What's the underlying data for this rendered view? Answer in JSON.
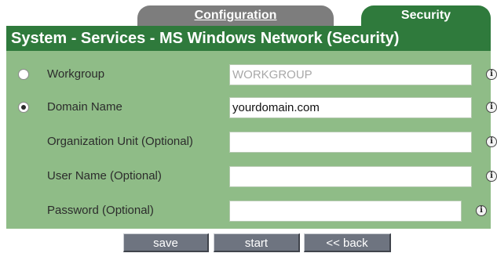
{
  "tabs": {
    "configuration": "Configuration",
    "security": "Security"
  },
  "title": "System - Services - MS Windows Network (Security)",
  "form": {
    "workgroup": {
      "label": "Workgroup",
      "value": "WORKGROUP",
      "selected": false,
      "disabled": true
    },
    "domain_name": {
      "label": "Domain Name",
      "value": "yourdomain.com",
      "selected": true
    },
    "organization_unit": {
      "label": "Organization Unit (Optional)",
      "value": ""
    },
    "user_name": {
      "label": "User Name (Optional)",
      "value": ""
    },
    "password": {
      "label": "Password (Optional)",
      "value": ""
    },
    "info_glyph": "i"
  },
  "buttons": {
    "save": "save",
    "start": "start",
    "back": "<< back"
  },
  "colors": {
    "tab_active": "#2f7a3c",
    "tab_inactive": "#7d7d7d",
    "form_background": "#8fbc87",
    "button": "#6e7480"
  }
}
